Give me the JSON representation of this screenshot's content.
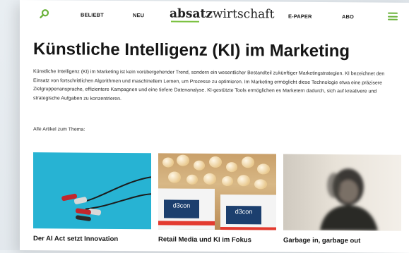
{
  "header": {
    "nav": {
      "beliebt": "BELIEBT",
      "neu": "NEU",
      "epaper": "E-PAPER",
      "abo": "ABO"
    },
    "logo": {
      "part1": "absatz",
      "part2": "wirtschaft"
    },
    "icons": {
      "search": "search-icon",
      "menu": "hamburger-menu-icon"
    },
    "accent_color": "#6ab23a"
  },
  "main": {
    "title": "Künstliche Intelligenz (KI) im Marketing",
    "intro": "Künstliche Intelligenz (KI) im Marketing ist kein vorübergehender Trend, sondern ein wesentlicher Bestandteil zukünftiger Marketingstrategien. KI bezeichnet den Einsatz von fortschrittlichen Algorithmen und maschinellem Lernen, um Prozesse zu optimieren. Im Marketing ermöglicht diese Technologie etwa eine präzisere Zielgruppenansprache, effizientere Kampagnen und eine tiefere Datenanalyse. KI-gestützte Tools ermöglichen es Marketern dadurch, sich auf kreativere und strategische Aufgaben zu konzentrieren.",
    "all_articles_label": "Alle Artikel zum Thema:"
  },
  "articles": [
    {
      "title": "Der AI Act setzt Innovation",
      "image": "alligator-clips-on-blue"
    },
    {
      "title": "Retail Media und KI im Fokus",
      "image": "popcorn-d3con-cups",
      "cup_label": "d3con"
    },
    {
      "title": "Garbage in, garbage out",
      "image": "blurred-person-portrait"
    }
  ]
}
